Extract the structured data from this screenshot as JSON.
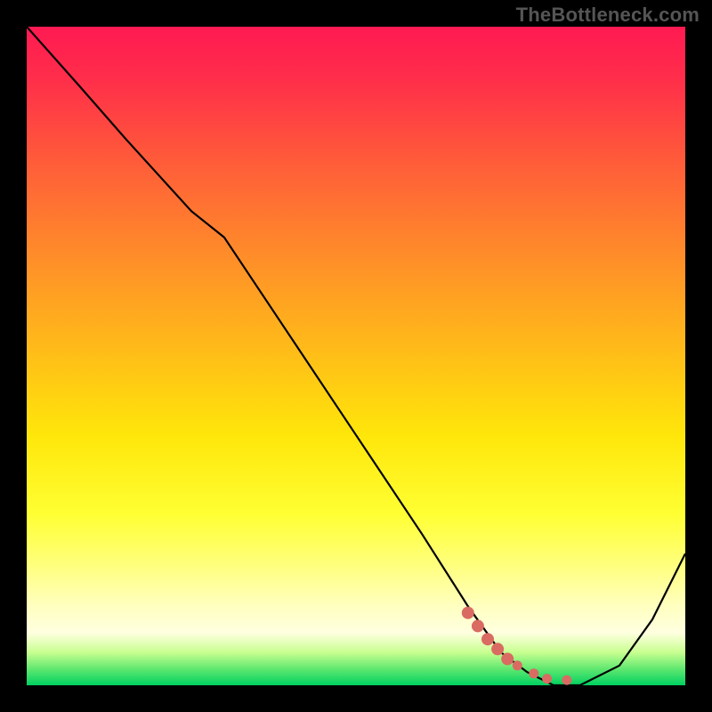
{
  "watermark": "TheBottleneck.com",
  "chart_data": {
    "type": "line",
    "title": "",
    "xlabel": "",
    "ylabel": "",
    "xlim": [
      0,
      100
    ],
    "ylim": [
      0,
      100
    ],
    "series": [
      {
        "name": "bottleneck-curve",
        "x": [
          0,
          8,
          15,
          25,
          30,
          40,
          50,
          60,
          67,
          72,
          76,
          80,
          84,
          90,
          95,
          100
        ],
        "y": [
          100,
          91,
          83,
          72,
          68,
          53,
          38,
          23,
          12,
          5,
          2,
          0,
          0,
          3,
          10,
          20
        ]
      }
    ],
    "markers": {
      "name": "highlight-dots",
      "x": [
        67,
        68.5,
        70,
        71.5,
        73,
        74.5,
        77,
        79,
        82
      ],
      "y": [
        11,
        9,
        7,
        5.5,
        4,
        3,
        1.8,
        1,
        0.8
      ]
    },
    "gradient_stops": [
      {
        "pct": 0,
        "color": "#ff1a52"
      },
      {
        "pct": 20,
        "color": "#ff5a3a"
      },
      {
        "pct": 48,
        "color": "#ffb81a"
      },
      {
        "pct": 74,
        "color": "#ffff33"
      },
      {
        "pct": 92,
        "color": "#ffffe0"
      },
      {
        "pct": 100,
        "color": "#00d060"
      }
    ]
  }
}
